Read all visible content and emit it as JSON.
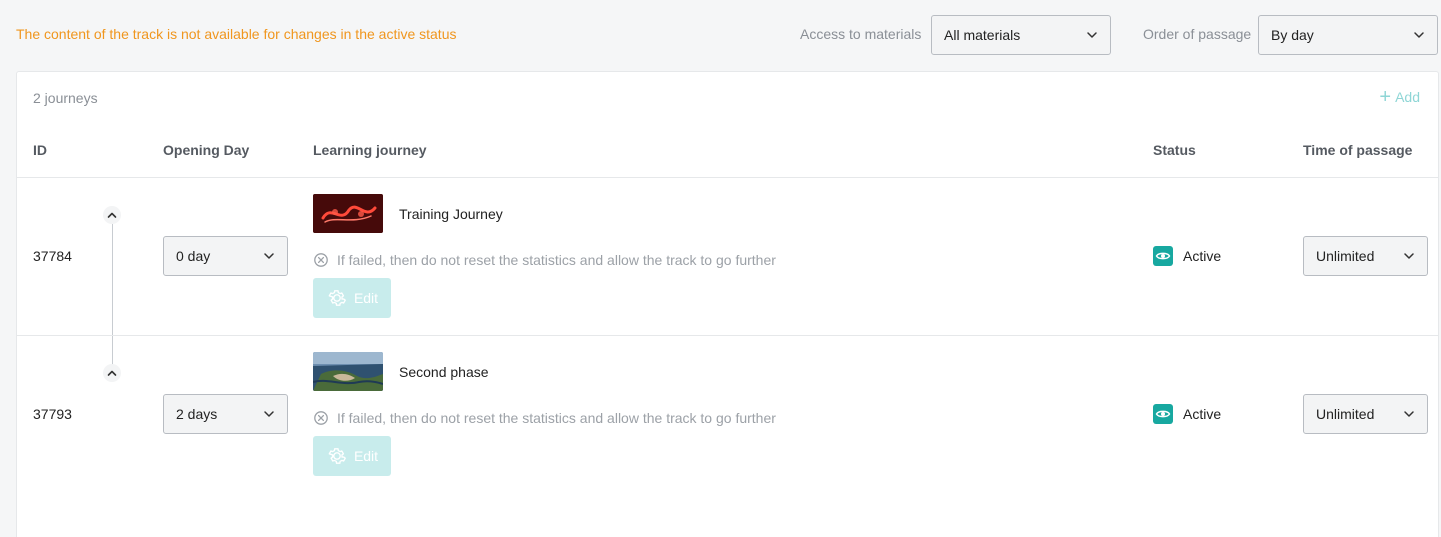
{
  "header": {
    "warning": "The content of the track is not available for changes in the active status",
    "access_label": "Access to materials",
    "access_value": "All materials",
    "order_label": "Order of passage",
    "order_value": "By day"
  },
  "panel": {
    "count": "2 journeys",
    "add_label": "Add",
    "columns": {
      "id": "ID",
      "opening_day": "Opening Day",
      "journey": "Learning journey",
      "status": "Status",
      "time": "Time of passage"
    },
    "rows": [
      {
        "id": "37784",
        "opening_day": "0 day",
        "name": "Training Journey",
        "note": "If failed, then do not reset the statistics and allow the track to go further",
        "edit_label": "Edit",
        "status": "Active",
        "time": "Unlimited"
      },
      {
        "id": "37793",
        "opening_day": "2 days",
        "name": "Second phase",
        "note": "If failed, then do not reset the statistics and allow the track to go further",
        "edit_label": "Edit",
        "status": "Active",
        "time": "Unlimited"
      }
    ]
  },
  "colors": {
    "warning": "#f0961e",
    "accent": "#17a8a0",
    "edit_disabled": "#c8ecec"
  }
}
